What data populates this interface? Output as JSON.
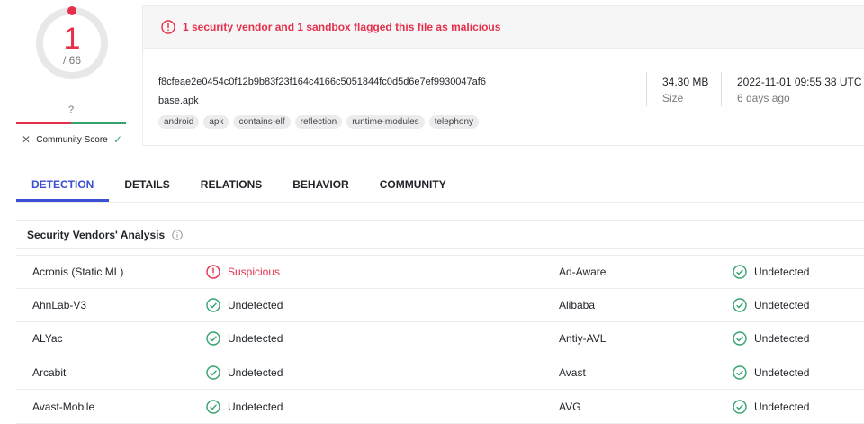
{
  "score": {
    "detections": "1",
    "total": "/ 66",
    "community_score_value": "?",
    "community_score_label": "Community Score",
    "accent_color": "#e5304b"
  },
  "alert": {
    "icon": "alert-circle-icon",
    "text": "1 security vendor and 1 sandbox flagged this file as malicious"
  },
  "file": {
    "hash": "f8cfeae2e0454c0f12b9b83f23f164c4166c5051844fc0d5d6e7ef9930047af6",
    "name": "base.apk",
    "tags": [
      "android",
      "apk",
      "contains-elf",
      "reflection",
      "runtime-modules",
      "telephony"
    ],
    "size_value": "34.30 MB",
    "size_label": "Size",
    "date_value": "2022-11-01 09:55:38 UTC",
    "date_label": "6 days ago"
  },
  "tabs": [
    "DETECTION",
    "DETAILS",
    "RELATIONS",
    "BEHAVIOR",
    "COMMUNITY"
  ],
  "section": {
    "title": "Security Vendors' Analysis"
  },
  "vendors": [
    {
      "left": "Acronis (Static ML)",
      "left_result": "Suspicious",
      "left_status": "bad",
      "right": "Ad-Aware",
      "right_result": "Undetected",
      "right_status": "ok"
    },
    {
      "left": "AhnLab-V3",
      "left_result": "Undetected",
      "left_status": "ok",
      "right": "Alibaba",
      "right_result": "Undetected",
      "right_status": "ok"
    },
    {
      "left": "ALYac",
      "left_result": "Undetected",
      "left_status": "ok",
      "right": "Antiy-AVL",
      "right_result": "Undetected",
      "right_status": "ok"
    },
    {
      "left": "Arcabit",
      "left_result": "Undetected",
      "left_status": "ok",
      "right": "Avast",
      "right_result": "Undetected",
      "right_status": "ok"
    },
    {
      "left": "Avast-Mobile",
      "left_result": "Undetected",
      "left_status": "ok",
      "right": "AVG",
      "right_result": "Undetected",
      "right_status": "ok"
    }
  ]
}
